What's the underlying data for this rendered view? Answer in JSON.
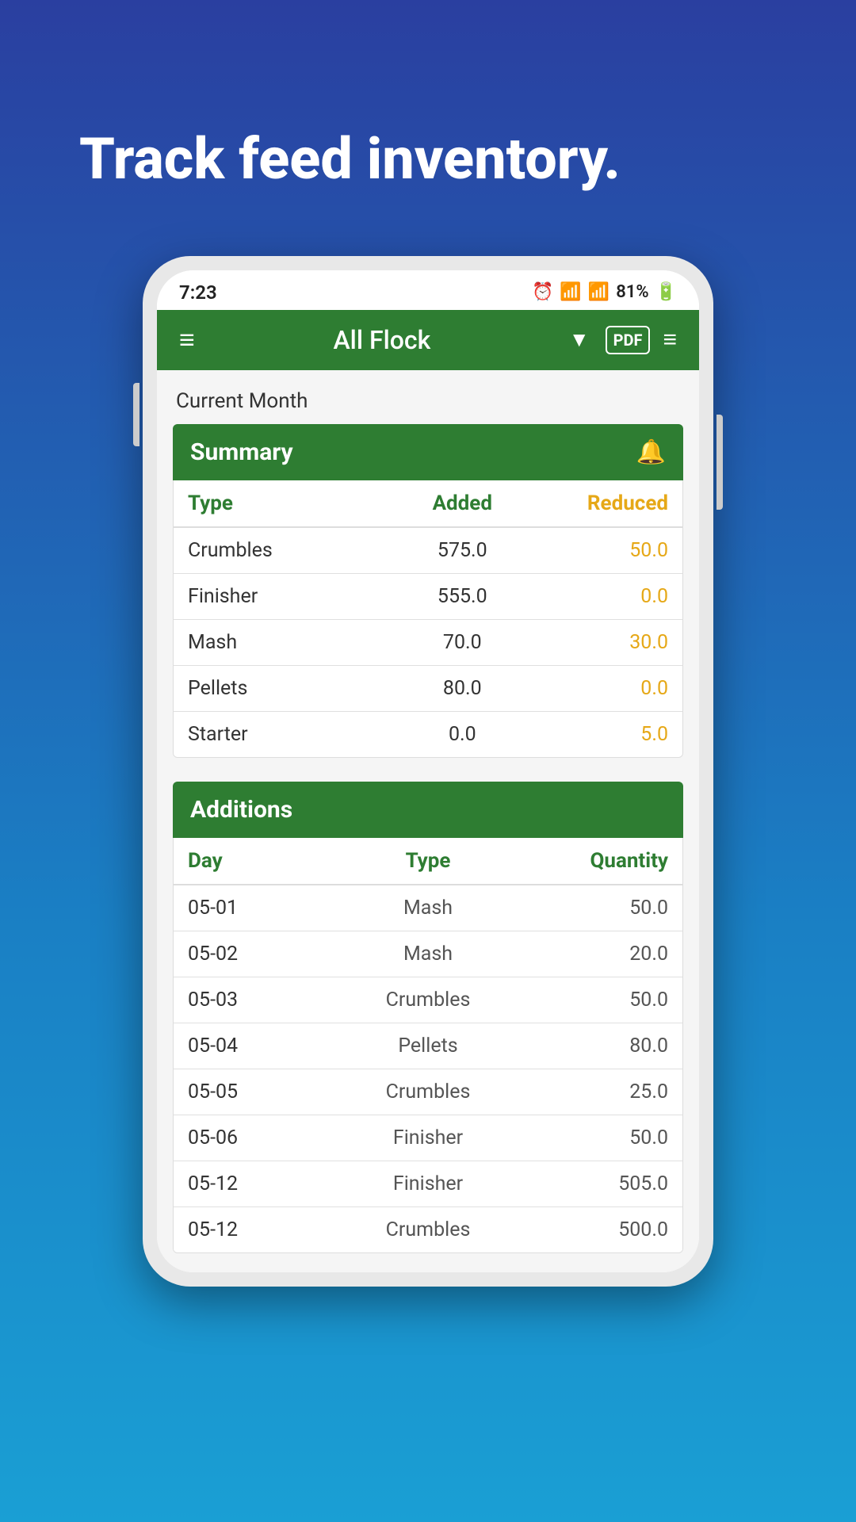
{
  "hero": {
    "title": "Track feed inventory."
  },
  "statusBar": {
    "time": "7:23",
    "battery": "81%"
  },
  "appBar": {
    "menuLabel": "≡",
    "title": "All Flock",
    "pdfLabel": "PDF",
    "dropdownSymbol": "▼"
  },
  "currentMonth": {
    "label": "Current Month"
  },
  "summary": {
    "title": "Summary",
    "headers": {
      "type": "Type",
      "added": "Added",
      "reduced": "Reduced"
    },
    "rows": [
      {
        "type": "Crumbles",
        "added": "575.0",
        "reduced": "50.0"
      },
      {
        "type": "Finisher",
        "added": "555.0",
        "reduced": "0.0"
      },
      {
        "type": "Mash",
        "added": "70.0",
        "reduced": "30.0"
      },
      {
        "type": "Pellets",
        "added": "80.0",
        "reduced": "0.0"
      },
      {
        "type": "Starter",
        "added": "0.0",
        "reduced": "5.0"
      }
    ]
  },
  "additions": {
    "title": "Additions",
    "headers": {
      "day": "Day",
      "type": "Type",
      "quantity": "Quantity"
    },
    "rows": [
      {
        "day": "05-01",
        "type": "Mash",
        "quantity": "50.0"
      },
      {
        "day": "05-02",
        "type": "Mash",
        "quantity": "20.0"
      },
      {
        "day": "05-03",
        "type": "Crumbles",
        "quantity": "50.0"
      },
      {
        "day": "05-04",
        "type": "Pellets",
        "quantity": "80.0"
      },
      {
        "day": "05-05",
        "type": "Crumbles",
        "quantity": "25.0"
      },
      {
        "day": "05-06",
        "type": "Finisher",
        "quantity": "50.0"
      },
      {
        "day": "05-12",
        "type": "Finisher",
        "quantity": "505.0"
      },
      {
        "day": "05-12",
        "type": "Crumbles",
        "quantity": "500.0"
      }
    ]
  }
}
